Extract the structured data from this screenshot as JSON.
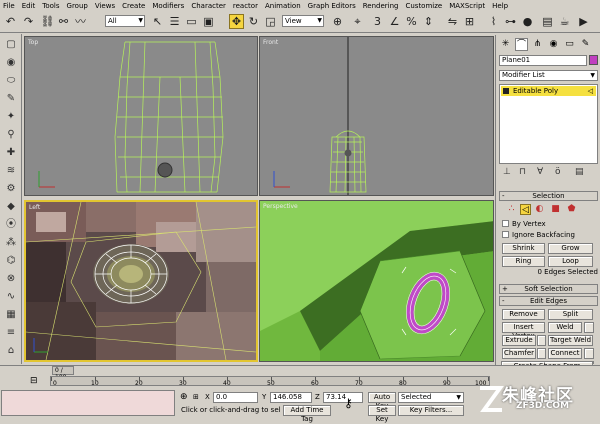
{
  "menu": [
    "File",
    "Edit",
    "Tools",
    "Group",
    "Views",
    "Create",
    "Modifiers",
    "Character",
    "reactor",
    "Animation",
    "Graph Editors",
    "Rendering",
    "Customize",
    "MAXScript",
    "Help"
  ],
  "toolbar": {
    "selection_filter": "All",
    "reference_coord": "View"
  },
  "viewports": {
    "top": "Top",
    "front": "Front",
    "left": "Left",
    "perspective": "Perspective"
  },
  "command_panel": {
    "object_name": "Plane01",
    "object_color": "#c040c0",
    "modifier_list": "Modifier List",
    "stack_item": "Editable Poly"
  },
  "selection_rollout": {
    "title": "Selection",
    "by_vertex": "By Vertex",
    "ignore_backfacing": "Ignore Backfacing",
    "shrink": "Shrink",
    "grow": "Grow",
    "ring": "Ring",
    "loop": "Loop",
    "status": "0 Edges Selected"
  },
  "soft_selection": {
    "title": "Soft Selection"
  },
  "edit_edges": {
    "title": "Edit Edges",
    "remove": "Remove",
    "split": "Split",
    "insert_vertex": "Insert Vertex",
    "weld": "Weld",
    "extrude": "Extrude",
    "target_weld": "Target Weld",
    "chamfer": "Chamfer",
    "connect": "Connect",
    "create_shape": "Create Shape From Selection"
  },
  "timeline": {
    "slider": "0 / 100",
    "ticks": [
      "0",
      "10",
      "20",
      "30",
      "40",
      "50",
      "60",
      "70",
      "80",
      "90",
      "100"
    ]
  },
  "status": {
    "x_label": "X",
    "x_value": "0.0",
    "y_label": "Y",
    "y_value": "146.058",
    "z_label": "Z",
    "z_value": "73.14",
    "prompt": "Click or click-and-drag to select ob",
    "add_time_tag": "Add Time Tag",
    "auto_key": "Auto Key",
    "auto_key_select": "Selected",
    "set_key": "Set Key",
    "key_filters": "Key Filters..."
  },
  "watermark": {
    "text": "朱峰社区",
    "url": "ZF3D.COM"
  }
}
